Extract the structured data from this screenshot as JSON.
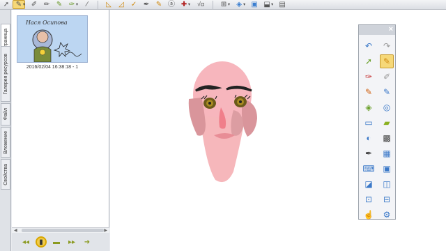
{
  "toolbar": {
    "left_icons": [
      "select-arrow-icon",
      "pen-icon",
      "eraser-icon",
      "highlighter-icon",
      "creative-pen-icon",
      "magic-pen-icon"
    ],
    "right_icons": [
      "triangle-icon",
      "protractor-icon",
      "compass-icon",
      "marker-icon",
      "pen-small-icon",
      "text-insert-icon",
      "cross-icon",
      "math-icon",
      "table-icon",
      "bucket-icon",
      "capture-icon",
      "document-camera-icon",
      "toolbar-settings-icon"
    ],
    "math_label": "√α"
  },
  "tabs": [
    {
      "label": "Страница"
    },
    {
      "label": "Галерея ресурсов"
    },
    {
      "label": "Файл"
    },
    {
      "label": "Вложение"
    },
    {
      "label": "Свойства"
    }
  ],
  "sorter": {
    "thumb_title": "Нася Осипова",
    "thumb_caption": "2016/02/04 16:38:18 - 1"
  },
  "floating_toolbar": {
    "close_label": "×",
    "buttons": [
      "undo-icon",
      "redo-icon",
      "select-icon",
      "pen-icon",
      "laser-pointer-icon",
      "eraser-icon",
      "highlighter-icon",
      "creative-pen-icon",
      "fill-bucket-icon",
      "shape-icon",
      "line-icon",
      "table-icon",
      "text-icon",
      "magic-pen-icon",
      "capture-icon",
      "camera-icon",
      "keyboard-icon",
      "document-camera-icon",
      "screen-shade-icon",
      "spotlight-icon",
      "magnifier-icon",
      "screen-capture-icon",
      "hand-icon",
      "settings-icon"
    ]
  }
}
